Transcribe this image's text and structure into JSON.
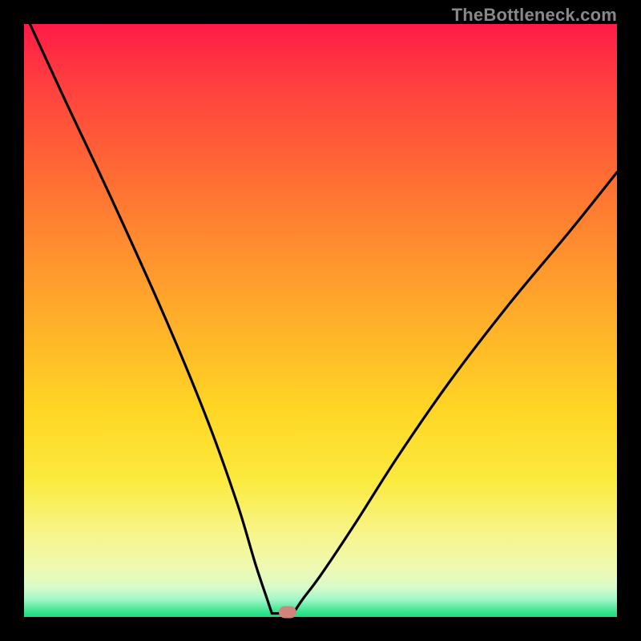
{
  "attribution": "TheBottleneck.com",
  "colors": {
    "curve": "#000000",
    "marker": "#d2837b",
    "frame_bg": "#000000"
  },
  "chart_data": {
    "type": "line",
    "title": "",
    "xlabel": "",
    "ylabel": "",
    "xlim": [
      0,
      100
    ],
    "ylim": [
      0,
      100
    ],
    "grid": false,
    "legend": false,
    "description": "V-shaped bottleneck curve on a vertical gradient from red (top, high bottleneck) to green (bottom, no bottleneck). Minimum near x≈43.",
    "notch": {
      "x": 43,
      "y": 0
    },
    "marker": {
      "x": 44.5,
      "y": 0.8
    },
    "series": [
      {
        "name": "bottleneck-curve",
        "x": [
          1,
          5,
          10,
          15,
          20,
          25,
          30,
          35,
          38,
          40,
          41,
          42,
          43,
          44,
          45,
          46,
          48,
          50,
          55,
          60,
          65,
          70,
          75,
          80,
          85,
          90,
          95,
          100
        ],
        "y": [
          100,
          90,
          79,
          68,
          57,
          46,
          35,
          23,
          14,
          7,
          4,
          1.5,
          0.5,
          0.5,
          1,
          1.8,
          4,
          7,
          15,
          23,
          31,
          38,
          45,
          52,
          58,
          64,
          70,
          75
        ]
      }
    ]
  }
}
